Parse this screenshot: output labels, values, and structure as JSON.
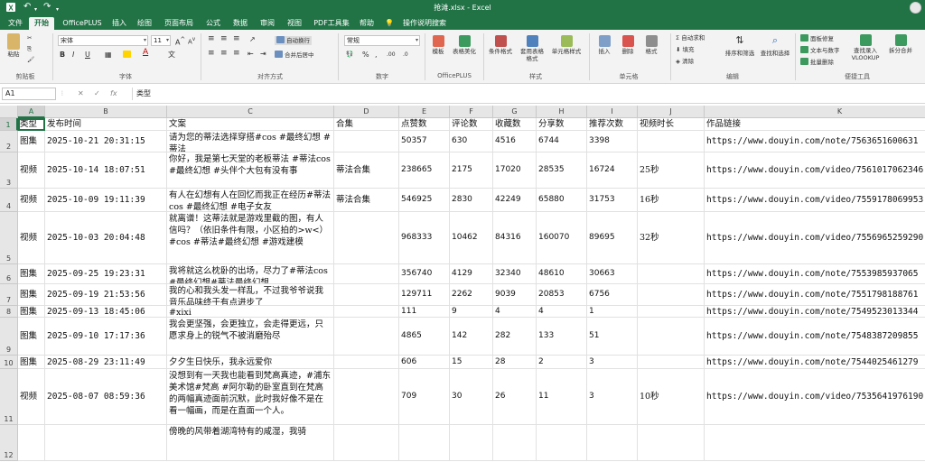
{
  "window": {
    "title": "抢滩.xlsx - Excel",
    "quick_access": {
      "app_icon": "excel-icon",
      "save_icon": "save-icon",
      "undo_icon": "undo-icon",
      "redo_icon": "redo-icon",
      "customize_icon": "customize-icon"
    }
  },
  "tabs": [
    "文件",
    "开始",
    "OfficePLUS",
    "插入",
    "绘图",
    "页面布局",
    "公式",
    "数据",
    "审阅",
    "视图",
    "PDF工具集",
    "帮助",
    "操作说明搜索"
  ],
  "active_tab": 1,
  "ribbon": {
    "clipboard": {
      "label": "剪贴板",
      "paste": "粘贴"
    },
    "font": {
      "label": "字体",
      "name": "宋体",
      "size": "11",
      "bold": "B",
      "italic": "I",
      "underline": "U"
    },
    "alignment": {
      "label": "对齐方式",
      "wrap_text": "自动换行",
      "merge_center": "合并后居中"
    },
    "number": {
      "label": "数字",
      "format": "常规"
    },
    "officeplus": {
      "label": "OfficePLUS",
      "template": "模板",
      "beautify": "表格美化"
    },
    "styles": {
      "label": "样式",
      "conditional": "条件格式",
      "table_format": "套用表格格式",
      "cell_styles": "单元格样式"
    },
    "cells": {
      "label": "单元格",
      "insert": "插入",
      "delete": "删除",
      "format": "格式"
    },
    "editing": {
      "label": "编辑",
      "autosum": "自动求和",
      "fill": "填充",
      "clear": "清除",
      "sort_filter": "排序和筛选",
      "find_select": "查找和选择"
    },
    "tools": {
      "label": "便捷工具",
      "repair": "面板修复",
      "text_number": "文本与数字",
      "batch_delete": "批量删除",
      "vlookup": "查找录入 VLOOKUP",
      "split_merge": "拆分合并"
    }
  },
  "formula_bar": {
    "name_box": "A1",
    "cancel": "✕",
    "enter": "✓",
    "fx": "fx",
    "content": "类型"
  },
  "columns": [
    "A",
    "B",
    "C",
    "D",
    "E",
    "F",
    "G",
    "H",
    "I",
    "J",
    "K"
  ],
  "rows": [
    {
      "num": "1",
      "cells": [
        "类型",
        "发布时间",
        "文案",
        "合集",
        "点赞数",
        "评论数",
        "收藏数",
        "分享数",
        "推荐次数",
        "视频时长",
        "作品链接"
      ]
    },
    {
      "num": "2",
      "cells": [
        "图集",
        "2025-10-21 20:31:15",
        "请为您的蒂法选择穿搭#cos #最终幻想 #蒂法",
        "",
        "50357",
        "630",
        "4516",
        "6744",
        "3398",
        "",
        "https://www.douyin.com/note/7563651600631"
      ]
    },
    {
      "num": "3",
      "cells": [
        "视频",
        "2025-10-14 18:07:51",
        "你好，我是第七天堂的老板蒂法 #蒂法cos #最终幻想 #头伴个大包有没有事",
        "蒂法合集",
        "238665",
        "2175",
        "17020",
        "28535",
        "16724",
        "25秒",
        "https://www.douyin.com/video/7561017062346"
      ]
    },
    {
      "num": "4",
      "cells": [
        "视频",
        "2025-10-09 19:11:39",
        "有人在幻想有人在回忆而我正在经历#蒂法cos #最终幻想 #电子女友",
        "蒂法合集",
        "546925",
        "2830",
        "42249",
        "65880",
        "31753",
        "16秒",
        "https://www.douyin.com/video/7559178069953"
      ]
    },
    {
      "num": "5",
      "cells": [
        "视频",
        "2025-10-03 20:04:48",
        "就离谱！这蒂法就是游戏里截的图，有人信吗？（依旧条件有限，小区拍的>w<）#cos #蒂法#最终幻想 #游戏建模",
        "",
        "968333",
        "10462",
        "84316",
        "160070",
        "89695",
        "32秒",
        "https://www.douyin.com/video/7556965259290"
      ]
    },
    {
      "num": "6",
      "cells": [
        "图集",
        "2025-09-25 19:23:31",
        "我将就这么枕卧的出场，尽力了#蒂法cos#最终幻想#蒂法最终幻想",
        "",
        "356740",
        "4129",
        "32340",
        "48610",
        "30663",
        "",
        "https://www.douyin.com/note/7553985937065"
      ]
    },
    {
      "num": "7",
      "cells": [
        "图集",
        "2025-09-19 21:53:56",
        "我的心和我头发一样乱，不过我爷爷说我音乐品味终于有点进步了",
        "",
        "129711",
        "2262",
        "9039",
        "20853",
        "6756",
        "",
        "https://www.douyin.com/note/7551798188761"
      ]
    },
    {
      "num": "8",
      "cells": [
        "图集",
        "2025-09-13 18:45:06",
        "#xixi",
        "",
        "111",
        "9",
        "4",
        "4",
        "1",
        "",
        "https://www.douyin.com/note/7549523013344"
      ]
    },
    {
      "num": "9",
      "cells": [
        "图集",
        "2025-09-10 17:17:36",
        "我会更坚强，会更独立，会走得更远，只愿求身上的锐气不被消磨殆尽",
        "",
        "4865",
        "142",
        "282",
        "133",
        "51",
        "",
        "https://www.douyin.com/note/7548387209855"
      ]
    },
    {
      "num": "10",
      "cells": [
        "图集",
        "2025-08-29 23:11:49",
        "夕夕生日快乐，我永远爱你",
        "",
        "606",
        "15",
        "28",
        "2",
        "3",
        "",
        "https://www.douyin.com/note/7544025461279"
      ]
    },
    {
      "num": "11",
      "cells": [
        "视频",
        "2025-08-07 08:59:36",
        "没想到有一天我也能看到梵高真迹，#浦东美术馆#梵高 #阿尔勒的卧室直到在梵高的两幅真迹面前沉默，此时我好像不是在看一幅画，而是在直面一个人。",
        "",
        "709",
        "30",
        "26",
        "11",
        "3",
        "10秒",
        "https://www.douyin.com/video/7535641976190"
      ]
    },
    {
      "num": "12",
      "cells": [
        "",
        "",
        "傍晚的风带着湖湾特有的咸湿，我骑",
        "",
        "",
        "",
        "",
        "",
        "",
        "",
        ""
      ]
    }
  ]
}
